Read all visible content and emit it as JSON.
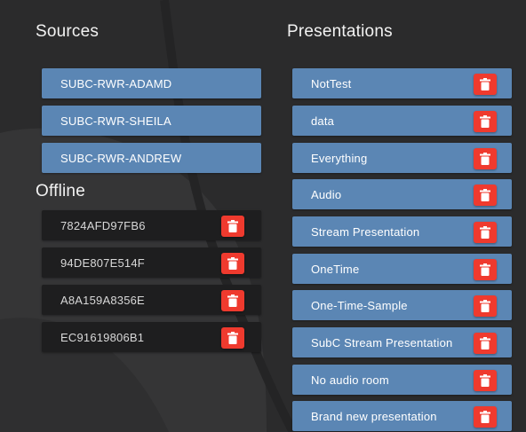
{
  "sources": {
    "title": "Sources",
    "items": [
      {
        "label": "SUBC-RWR-ADAMD"
      },
      {
        "label": "SUBC-RWR-SHEILA"
      },
      {
        "label": "SUBC-RWR-ANDREW"
      }
    ]
  },
  "offline": {
    "title": "Offline",
    "items": [
      {
        "label": "7824AFD97FB6"
      },
      {
        "label": "94DE807E514F"
      },
      {
        "label": "A8A159A8356E"
      },
      {
        "label": "EC91619806B1"
      }
    ]
  },
  "presentations": {
    "title": "Presentations",
    "items": [
      {
        "label": "NotTest"
      },
      {
        "label": "data"
      },
      {
        "label": "Everything"
      },
      {
        "label": "Audio"
      },
      {
        "label": "Stream Presentation"
      },
      {
        "label": "OneTime"
      },
      {
        "label": "One-Time-Sample"
      },
      {
        "label": "SubC Stream Presentation"
      },
      {
        "label": "No audio room"
      },
      {
        "label": "Brand new presentation"
      }
    ]
  },
  "icons": {
    "delete": "trash-icon"
  },
  "colors": {
    "background": "#2b2b2c",
    "source_button": "#5b86b4",
    "offline_row": "#1e1e1f",
    "delete_button": "#ef3a2e"
  }
}
